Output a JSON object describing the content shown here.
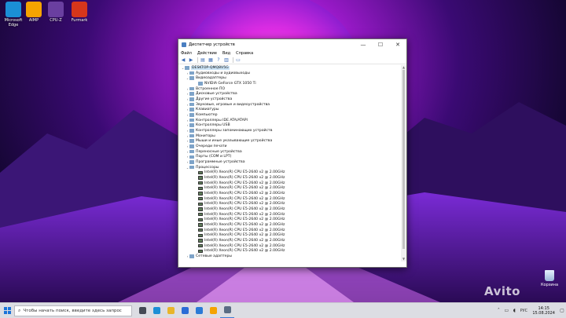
{
  "desktop_icons": [
    {
      "label": "Microsoft Edge",
      "color": "#1b8fd6"
    },
    {
      "label": "AIMP",
      "color": "#f5a300"
    },
    {
      "label": "CPU-Z",
      "color": "#6a3fa0"
    },
    {
      "label": "Furmark",
      "color": "#d6361b"
    }
  ],
  "window": {
    "title": "Диспетчер устройств",
    "menu": [
      "Файл",
      "Действие",
      "Вид",
      "Справка"
    ],
    "controls": {
      "minimize": "—",
      "maximize": "☐",
      "close": "✕"
    }
  },
  "tree": {
    "root": "DESKTOP-QMQ8V5G",
    "gpu_category": "Видеоадаптеры",
    "gpu_device": "NVIDIA GeForce GTX 1050 Ti",
    "categories_before": [
      "Аудиовходы и аудиовыходы"
    ],
    "categories_middle": [
      "Встроенное ПО",
      "Дисковые устройства",
      "Другие устройства",
      "Звуковые, игровые и видеоустройства",
      "Клавиатуры",
      "Компьютер",
      "Контроллеры IDE ATA/ATAPI",
      "Контроллеры USB",
      "Контроллеры запоминающих устройств",
      "Мониторы",
      "Мыши и иные указывающие устройства",
      "Очереди печати",
      "Переносные устройства",
      "Порты (COM и LPT)",
      "Программные устройства"
    ],
    "processors_category": "Процессоры",
    "processors": [
      "Intel(R) Xeon(R) CPU E5-2640 v2 @ 2.00GHz",
      "Intel(R) Xeon(R) CPU E5-2640 v2 @ 2.00GHz",
      "Intel(R) Xeon(R) CPU E5-2640 v2 @ 2.00GHz",
      "Intel(R) Xeon(R) CPU E5-2640 v2 @ 2.00GHz",
      "Intel(R) Xeon(R) CPU E5-2640 v2 @ 2.00GHz",
      "Intel(R) Xeon(R) CPU E5-2640 v2 @ 2.00GHz",
      "Intel(R) Xeon(R) CPU E5-2640 v2 @ 2.00GHz",
      "Intel(R) Xeon(R) CPU E5-2640 v2 @ 2.00GHz",
      "Intel(R) Xeon(R) CPU E5-2640 v2 @ 2.00GHz",
      "Intel(R) Xeon(R) CPU E5-2640 v2 @ 2.00GHz",
      "Intel(R) Xeon(R) CPU E5-2640 v2 @ 2.00GHz",
      "Intel(R) Xeon(R) CPU E5-2640 v2 @ 2.00GHz",
      "Intel(R) Xeon(R) CPU E5-2640 v2 @ 2.00GHz",
      "Intel(R) Xeon(R) CPU E5-2640 v2 @ 2.00GHz",
      "Intel(R) Xeon(R) CPU E5-2640 v2 @ 2.00GHz",
      "Intel(R) Xeon(R) CPU E5-2640 v2 @ 2.00GHz"
    ],
    "categories_after": [
      "Сетевые адаптеры"
    ]
  },
  "recycle_bin": {
    "label": "Корзина"
  },
  "watermark": "Avito",
  "taskbar": {
    "search_placeholder": "Чтобы начать поиск, введите здесь запрос",
    "apps": [
      {
        "name": "task-view",
        "color": "#444a55"
      },
      {
        "name": "edge",
        "color": "#1b8fd6"
      },
      {
        "name": "explorer",
        "color": "#e8b52a"
      },
      {
        "name": "store",
        "color": "#2b6cd6"
      },
      {
        "name": "mail",
        "color": "#2a7ad6"
      },
      {
        "name": "aimp",
        "color": "#f5a300"
      },
      {
        "name": "device-manager",
        "color": "#5a6c84",
        "active": true
      }
    ],
    "language": "РУС",
    "time": "14:15",
    "date": "15.08.2024"
  },
  "accent_color": "#3a7bd5"
}
